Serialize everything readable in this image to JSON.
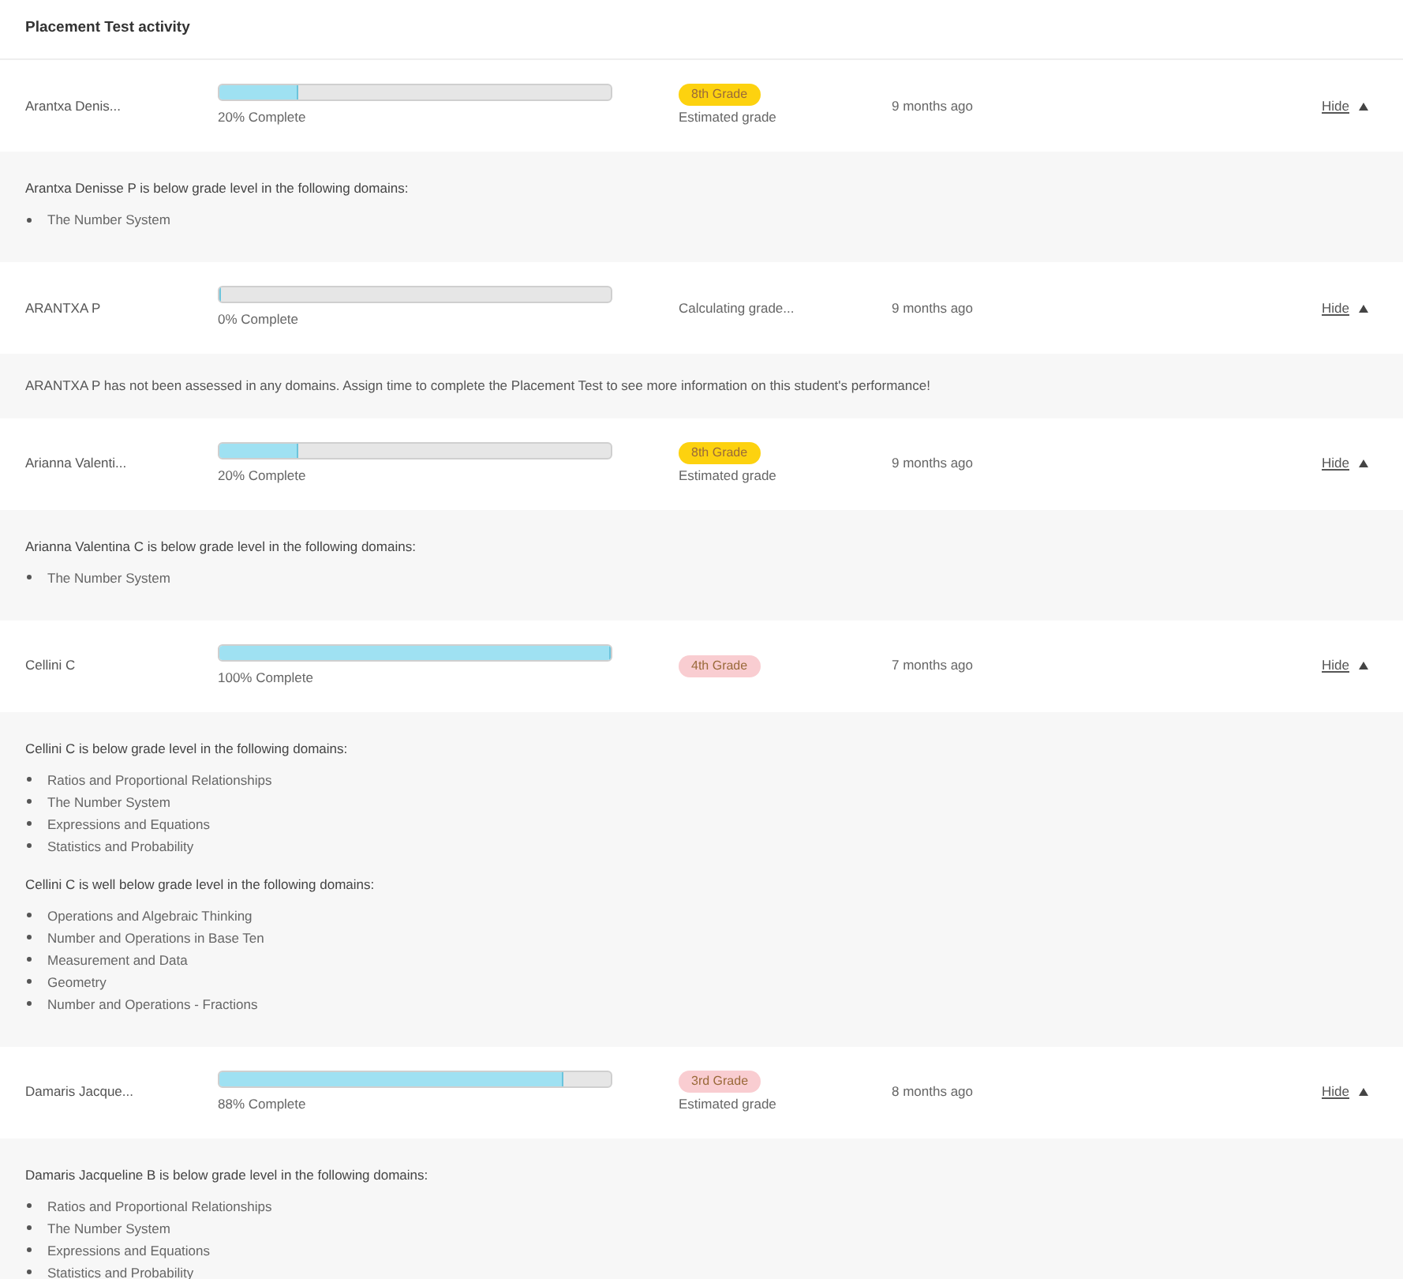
{
  "title": "Placement Test activity",
  "students": [
    {
      "name": "Arantxa Denis...",
      "level": 0.2,
      "progress": "20% Complete",
      "grade": {
        "label": "8th Grade",
        "color": "#fdd20f"
      },
      "grade_note": "Estimated grade",
      "time": "9 months ago",
      "toggle": "Hide",
      "expanded": true,
      "detail": {
        "sections": [
          {
            "heading": "Arantxa Denisse P is below grade level in the following domains:",
            "items": [
              "The Number System"
            ]
          }
        ]
      }
    },
    {
      "name": "ARANTXA P",
      "level": 0,
      "progress": "0% Complete",
      "grade_status": "Calculating grade...",
      "time": "9 months ago",
      "toggle": "Hide",
      "expanded": true,
      "detail": {
        "message": "ARANTXA P has not been assessed in any domains. Assign time to complete the Placement Test to see more information on this student's performance!"
      }
    },
    {
      "name": "Arianna Valenti...",
      "level": 0.2,
      "progress": "20% Complete",
      "grade": {
        "label": "8th Grade",
        "color": "#fdd20f"
      },
      "grade_note": "Estimated grade",
      "time": "9 months ago",
      "toggle": "Hide",
      "expanded": true,
      "detail": {
        "sections": [
          {
            "heading": "Arianna Valentina C is below grade level in the following domains:",
            "items": [
              "The Number System"
            ]
          }
        ]
      }
    },
    {
      "name": "Cellini C",
      "level": 1,
      "progress": "100% Complete",
      "grade": {
        "label": "4th Grade",
        "color": "#f9cdd1"
      },
      "time": "7 months ago",
      "toggle": "Hide",
      "expanded": true,
      "detail": {
        "sections": [
          {
            "heading": "Cellini C is below grade level in the following domains:",
            "items": [
              "Ratios and Proportional Relationships",
              "The Number System",
              "Expressions and Equations",
              "Statistics and Probability"
            ]
          },
          {
            "heading": "Cellini C is well below grade level in the following domains:",
            "items": [
              "Operations and Algebraic Thinking",
              "Number and Operations in Base Ten",
              "Measurement and Data",
              "Geometry",
              "Number and Operations - Fractions"
            ]
          }
        ]
      }
    },
    {
      "name": "Damaris Jacque...",
      "level": 0.88,
      "progress": "88% Complete",
      "grade": {
        "label": "3rd Grade",
        "color": "#f9cdd1"
      },
      "grade_note": "Estimated grade",
      "time": "8 months ago",
      "toggle": "Hide",
      "expanded": true,
      "detail": {
        "sections": [
          {
            "heading": "Damaris Jacqueline B is below grade level in the following domains:",
            "items": [
              "Ratios and Proportional Relationships",
              "The Number System",
              "Expressions and Equations",
              "Statistics and Probability"
            ]
          }
        ]
      }
    }
  ]
}
